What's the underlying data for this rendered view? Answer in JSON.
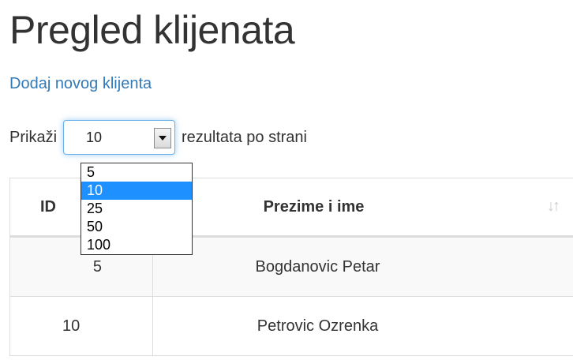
{
  "page": {
    "title": "Pregled klijenata",
    "add_link": "Dodaj novog klijenta"
  },
  "length_menu": {
    "prefix": "Prikaži",
    "selected_value": "10",
    "suffix": "rezultata po strani",
    "options": [
      "5",
      "10",
      "25",
      "50",
      "100"
    ],
    "highlighted_option": "10"
  },
  "table": {
    "headers": {
      "id": "ID",
      "name": "Prezime i ime"
    },
    "sort_icon": "sort-arrows-icon",
    "rows": [
      {
        "id": "5",
        "name": "Bogdanovic Petar"
      },
      {
        "id": "10",
        "name": "Petrovic Ozrenka"
      }
    ]
  },
  "colors": {
    "link": "#337ab7",
    "focus_border": "#66afe9",
    "option_highlight": "#1e90ff",
    "row_stripe": "#f9f9f9"
  }
}
